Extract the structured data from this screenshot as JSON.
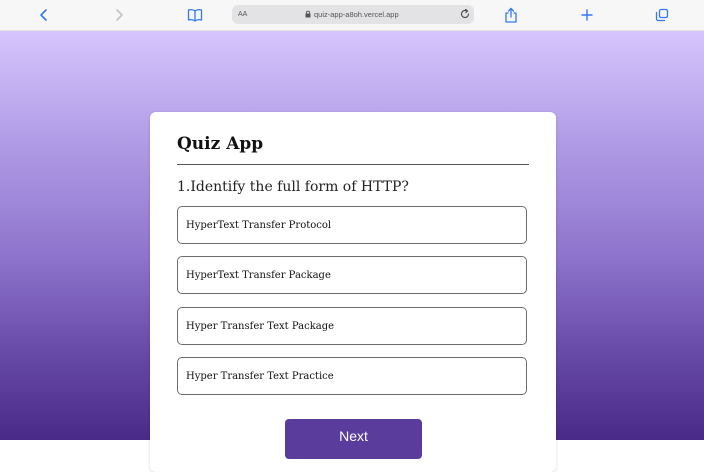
{
  "browser": {
    "text_size_label": "AA",
    "url": "quiz-app-a8oh.vercel.app",
    "toolbar_icons": [
      "back-icon",
      "forward-icon",
      "bookmarks-icon",
      "share-icon",
      "new-tab-icon",
      "tabs-icon"
    ],
    "icon_color": "#3478f6"
  },
  "quiz": {
    "title": "Quiz App",
    "question": "1.Identify the full form of HTTP?",
    "options": [
      "HyperText Transfer Protocol",
      "HyperText Transfer Package",
      "Hyper Transfer Text Package",
      "Hyper Transfer Text Practice"
    ],
    "next_label": "Next"
  },
  "colors": {
    "background_top": "#d6c5fd",
    "background_bottom": "#4a2a88",
    "button": "#5a3c9c"
  }
}
